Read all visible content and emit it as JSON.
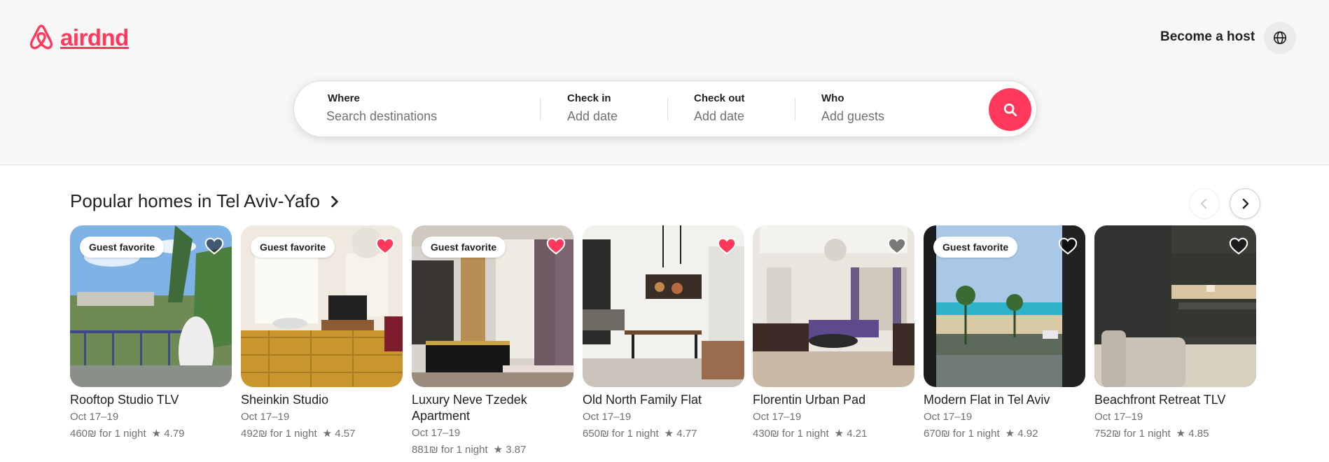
{
  "brand": {
    "name": "airdnd",
    "color": "#ff385c"
  },
  "header": {
    "become_host": "Become a host"
  },
  "search": {
    "where_label": "Where",
    "where_placeholder": "Search destinations",
    "checkin_label": "Check in",
    "checkin_placeholder": "Add date",
    "checkout_label": "Check out",
    "checkout_placeholder": "Add date",
    "who_label": "Who",
    "who_placeholder": "Add guests"
  },
  "section": {
    "title": "Popular homes in Tel Aviv-Yafo"
  },
  "listings": [
    {
      "title": "Rooftop Studio TLV",
      "dates": "Oct 17–19",
      "price": "460₪ for 1 night",
      "rating": "4.79",
      "badge": "Guest favorite",
      "favorited": false
    },
    {
      "title": "Sheinkin Studio",
      "dates": "Oct 17–19",
      "price": "492₪ for 1 night",
      "rating": "4.57",
      "badge": "Guest favorite",
      "favorited": true
    },
    {
      "title": "Luxury Neve Tzedek Apartment",
      "dates": "Oct 17–19",
      "price": "881₪ for 1 night",
      "rating": "3.87",
      "badge": "Guest favorite",
      "favorited": true
    },
    {
      "title": "Old North Family Flat",
      "dates": "Oct 17–19",
      "price": "650₪ for 1 night",
      "rating": "4.77",
      "badge": "",
      "favorited": true
    },
    {
      "title": "Florentin Urban Pad",
      "dates": "Oct 17–19",
      "price": "430₪ for 1 night",
      "rating": "4.21",
      "badge": "",
      "favorited": false
    },
    {
      "title": "Modern Flat in Tel Aviv",
      "dates": "Oct 17–19",
      "price": "670₪ for 1 night",
      "rating": "4.92",
      "badge": "Guest favorite",
      "favorited": false
    },
    {
      "title": "Beachfront Retreat TLV",
      "dates": "Oct 17–19",
      "price": "752₪ for 1 night",
      "rating": "4.85",
      "badge": "",
      "favorited": false
    }
  ]
}
